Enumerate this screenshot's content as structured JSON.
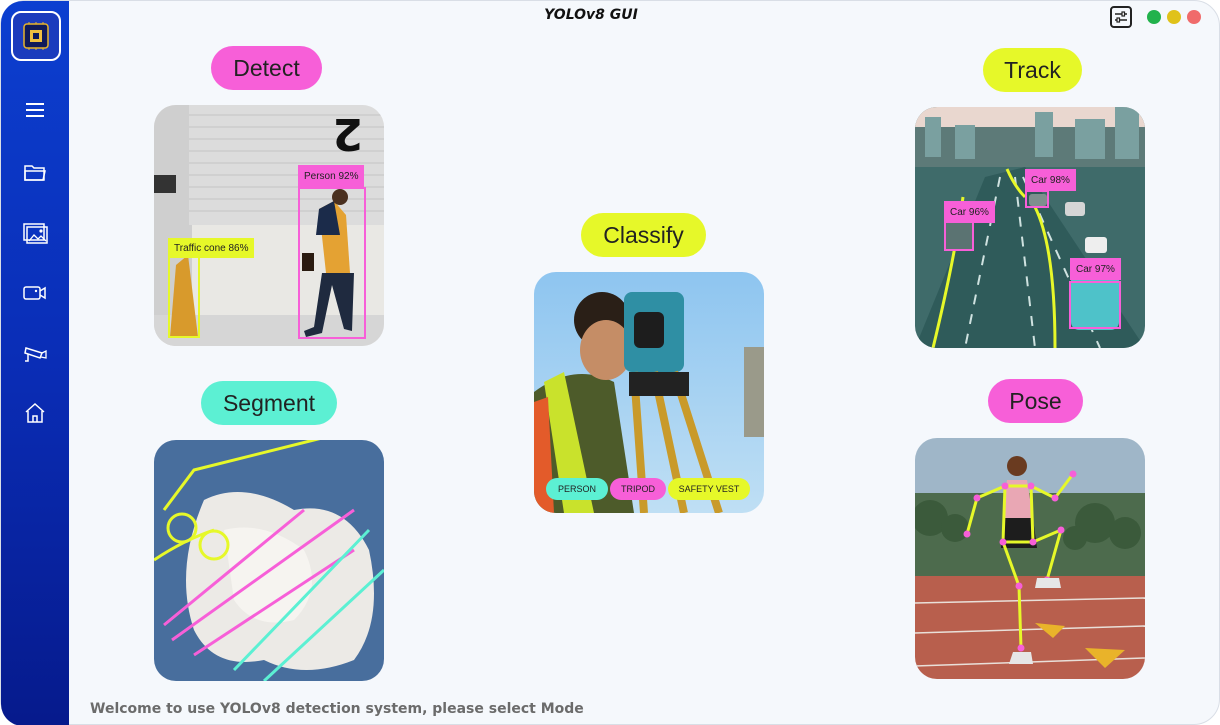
{
  "window": {
    "title": "YOLOv8 GUI",
    "status_text": "Welcome to use YOLOv8 detection system, please select Mode"
  },
  "sidebar": {
    "items": [
      {
        "icon": "menu-icon"
      },
      {
        "icon": "folder-icon"
      },
      {
        "icon": "image-icon"
      },
      {
        "icon": "video-camera-icon"
      },
      {
        "icon": "cctv-camera-icon"
      },
      {
        "icon": "home-icon"
      }
    ]
  },
  "titlebar": {
    "settings_icon": "sliders-icon",
    "controls": [
      {
        "name": "minimize",
        "color": "#22b24c"
      },
      {
        "name": "maximize",
        "color": "#e0c21a"
      },
      {
        "name": "close",
        "color": "#f06b6b"
      }
    ]
  },
  "modes": {
    "detect": {
      "label": "Detect",
      "color": "#f75fd8",
      "boxes": [
        {
          "label": "Person  92%"
        },
        {
          "label": "Traffic cone  86%"
        }
      ]
    },
    "track": {
      "label": "Track",
      "color": "#e6f829",
      "boxes": [
        {
          "label": "Car  98%"
        },
        {
          "label": "Car  96%"
        },
        {
          "label": "Car  97%"
        }
      ]
    },
    "classify": {
      "label": "Classify",
      "color": "#e6f829",
      "tags": [
        {
          "label": "PERSON",
          "color": "#5cf0d3"
        },
        {
          "label": "TRIPOD",
          "color": "#f75fd8"
        },
        {
          "label": "SAFETY VEST",
          "color": "#e6f829"
        }
      ]
    },
    "segment": {
      "label": "Segment",
      "color": "#5cf0d3"
    },
    "pose": {
      "label": "Pose",
      "color": "#f75fd8"
    }
  }
}
